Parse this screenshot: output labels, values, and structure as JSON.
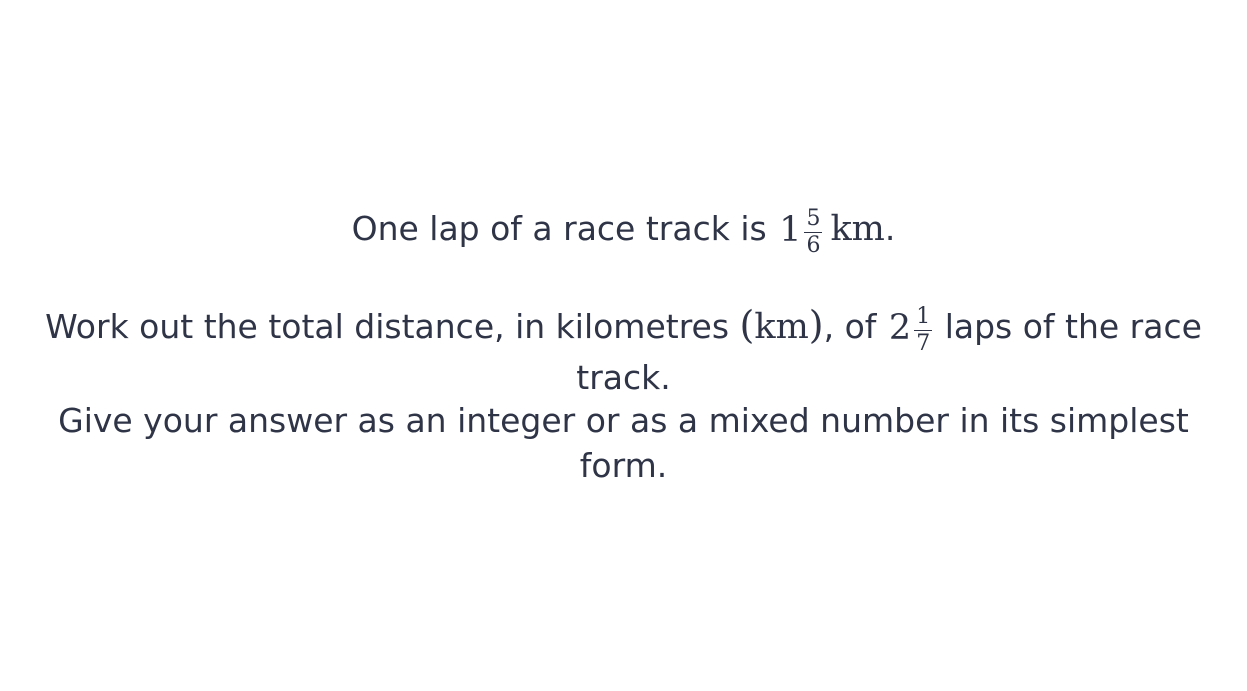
{
  "question": {
    "line1": {
      "text_before": "One lap of a race track is",
      "lap_length": {
        "whole": "1",
        "numerator": "5",
        "denominator": "6"
      },
      "unit": "km",
      "end_punct": "."
    },
    "line2": {
      "text_before": "Work out the total distance, in kilometres",
      "paren_open": "(",
      "unit": "km",
      "paren_close": ")",
      "text_mid": ", of",
      "laps": {
        "whole": "2",
        "numerator": "1",
        "denominator": "7"
      },
      "text_after": "laps of the race",
      "wrap": "track."
    },
    "line3": {
      "text": "Give your answer as an integer or as a mixed number in its simplest",
      "wrap": "form."
    }
  }
}
